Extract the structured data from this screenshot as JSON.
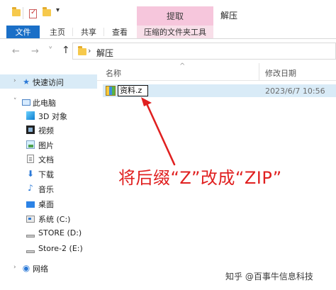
{
  "window": {
    "title": "解压",
    "context_tab_header": "提取"
  },
  "quick_access_toolbar": {
    "folder_icon": "folder-icon",
    "properties_icon": "properties-icon",
    "dropdown_icon": "chevron-down-icon"
  },
  "ribbon": {
    "tabs": [
      {
        "label": "文件"
      },
      {
        "label": "主页"
      },
      {
        "label": "共享"
      },
      {
        "label": "查看"
      },
      {
        "label": "压缩的文件夹工具"
      }
    ]
  },
  "address_bar": {
    "back_icon": "←",
    "forward_icon": "→",
    "recent_icon": "˅",
    "up_icon": "↑",
    "path_separator": "›",
    "path": "解压"
  },
  "navigation": {
    "items": [
      {
        "label": "快速访问",
        "icon": "star-icon"
      },
      {
        "label": "此电脑",
        "icon": "computer-icon"
      },
      {
        "label": "3D 对象",
        "icon": "3d-objects-icon"
      },
      {
        "label": "视频",
        "icon": "video-icon"
      },
      {
        "label": "图片",
        "icon": "picture-icon"
      },
      {
        "label": "文档",
        "icon": "document-icon"
      },
      {
        "label": "下载",
        "icon": "download-icon"
      },
      {
        "label": "音乐",
        "icon": "music-icon"
      },
      {
        "label": "桌面",
        "icon": "desktop-icon"
      },
      {
        "label": "系统 (C:)",
        "icon": "drive-icon"
      },
      {
        "label": "STORE (D:)",
        "icon": "drive-icon"
      },
      {
        "label": "Store-2 (E:)",
        "icon": "drive-icon"
      },
      {
        "label": "网络",
        "icon": "network-icon"
      }
    ]
  },
  "file_list": {
    "columns": {
      "name": "名称",
      "modified": "修改日期"
    },
    "files": [
      {
        "name_editing": "资料.z",
        "modified": "2023/6/7 10:56",
        "icon": "winrar-archive-icon"
      }
    ]
  },
  "annotation": {
    "text": "将后缀“Z”改成“ZIP”",
    "color": "#e02020"
  },
  "watermark": "知乎 @百事牛信息科技"
}
